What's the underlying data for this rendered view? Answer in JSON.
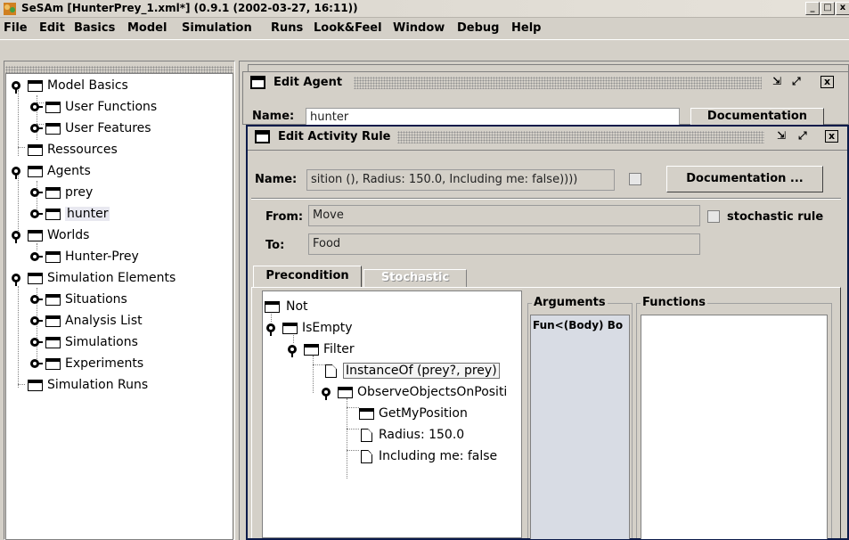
{
  "window": {
    "title": "SeSAm [HunterPrey_1.xml*] (0.9.1 (2002-03-27, 16:11))",
    "controls": {
      "minimize": "_",
      "maximize": "□",
      "close": "x"
    }
  },
  "menu": [
    "File",
    "Edit",
    "Basics",
    "Model",
    "Simulation",
    "Runs",
    "Look&Feel",
    "Window",
    "Debug",
    "Help"
  ],
  "model_tree": {
    "items": [
      "Model Basics",
      "User Functions",
      "User Features",
      "Ressources",
      "Agents",
      "prey",
      "hunter",
      "Worlds",
      "Hunter-Prey",
      "Simulation Elements",
      "Situations",
      "Analysis List",
      "Simulations",
      "Experiments",
      "Simulation Runs"
    ]
  },
  "edit_agent": {
    "title": "Edit Agent",
    "name_label": "Name:",
    "name_value": "hunter",
    "documentation_label": "Documentation"
  },
  "edit_rule": {
    "title": "Edit Activity Rule",
    "name_label": "Name:",
    "name_value": "sition (), Radius: 150.0, Including me: false))))",
    "documentation_label": "Documentation ...",
    "from_label": "From:",
    "from_value": "Move",
    "to_label": "To:",
    "to_value": "Food",
    "stochastic_label": "stochastic rule",
    "tabs": [
      "Precondition",
      "Stochastic"
    ],
    "tree": [
      "Not",
      "IsEmpty",
      "Filter",
      "InstanceOf (prey?, prey)",
      "ObserveObjectsOnPositi",
      "GetMyPosition",
      "Radius: 150.0",
      "Including me: false"
    ],
    "arguments_label": "Arguments",
    "arguments_item": "Fun<(Body) Bo",
    "functions_label": "Functions",
    "frame_controls": {
      "iconify": "⧉",
      "maximize": "⤢",
      "close": "x"
    }
  }
}
